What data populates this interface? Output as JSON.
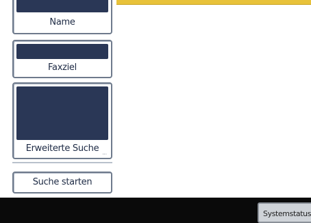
{
  "left_panel": {
    "name_button": {
      "label": "Name"
    },
    "faxziel_button": {
      "label": "Faxziel"
    },
    "advanced_search_button": {
      "label": "Erweiterte Suche",
      "more_indicator": "..."
    },
    "start_search_button": {
      "label": "Suche starten"
    }
  },
  "footer": {
    "system_status_button": {
      "label": "Systemstatus"
    }
  },
  "colors": {
    "accent_top_line": "#e8c23a",
    "button_dark_fill": "#2a3756",
    "footer_bar": "#0a0a0a"
  }
}
